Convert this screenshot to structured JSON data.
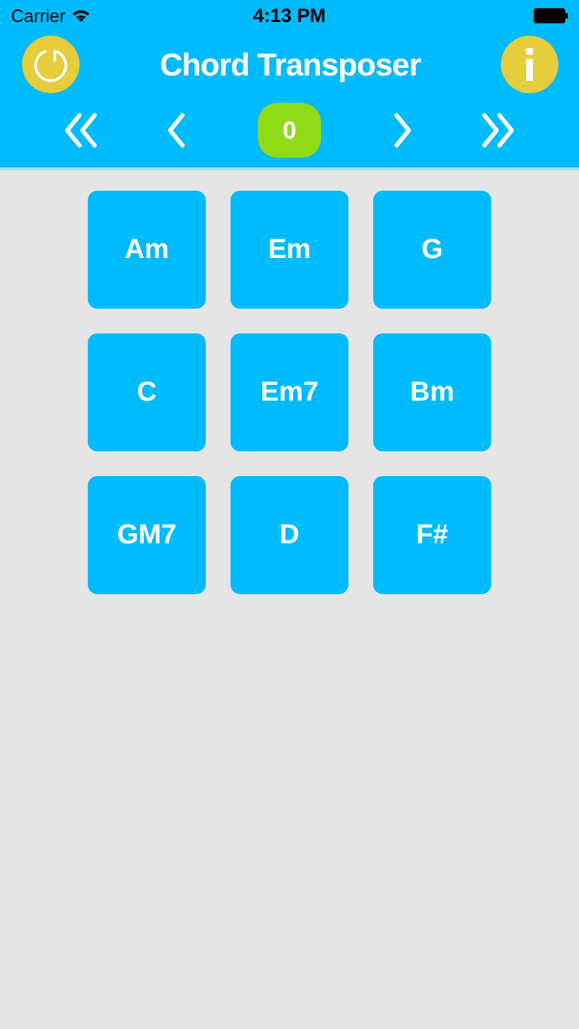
{
  "status_bar": {
    "carrier": "Carrier",
    "time": "4:13 PM"
  },
  "header": {
    "title": "Chord Transposer"
  },
  "transpose": {
    "value": "0"
  },
  "chords": [
    {
      "label": "Am"
    },
    {
      "label": "Em"
    },
    {
      "label": "G"
    },
    {
      "label": "C"
    },
    {
      "label": "Em7"
    },
    {
      "label": "Bm"
    },
    {
      "label": "GM7"
    },
    {
      "label": "D"
    },
    {
      "label": "F#"
    }
  ]
}
